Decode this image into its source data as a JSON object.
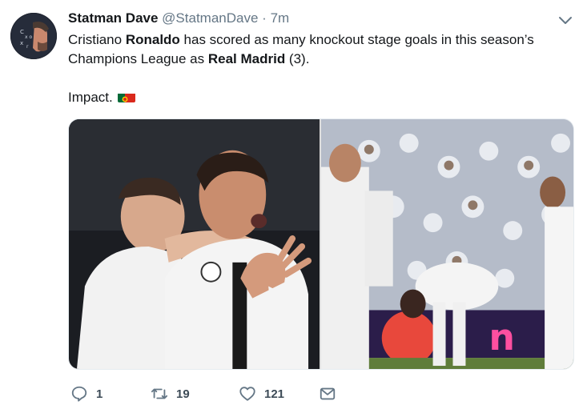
{
  "tweet": {
    "author_name": "Statman Dave",
    "handle": "@StatmanDave",
    "separator": "·",
    "time": "7m",
    "text_part1": "Cristiano ",
    "text_bold1": "Ronaldo",
    "text_part2": " has scored as many knockout stage goals in this season’s Champions League as ",
    "text_bold2": "Real Madrid",
    "text_part3": " (3).",
    "text_line2": "Impact.",
    "flag_icon": "portugal-flag"
  },
  "actions": {
    "reply_count": "1",
    "retweet_count": "19",
    "like_count": "121"
  },
  "icons": {
    "reply": "speech-bubble-icon",
    "retweet": "retweet-arrows-icon",
    "like": "heart-icon",
    "message": "envelope-icon",
    "menu": "chevron-down-icon"
  },
  "colors": {
    "text": "#14171a",
    "secondary": "#657786",
    "border": "#e6ecf0"
  }
}
